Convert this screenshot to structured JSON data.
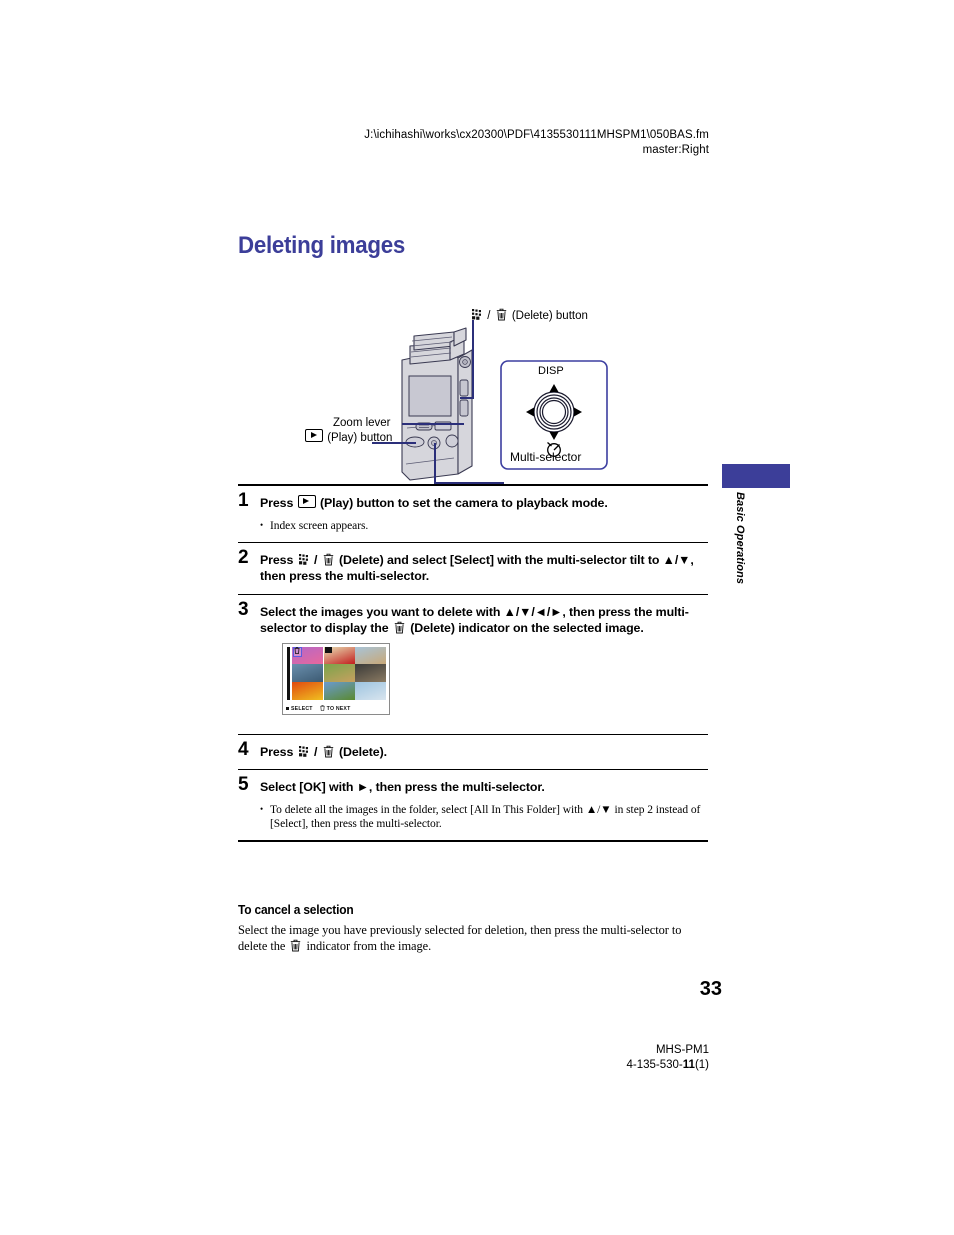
{
  "header": {
    "file_path": "J:\\ichihashi\\works\\cx20300\\PDF\\4135530111MHSPM1\\050BAS.fm",
    "master": "master:Right"
  },
  "title": "Deleting images",
  "figure": {
    "delete_button_label": "(Delete) button",
    "zoom_lever_label": "Zoom lever",
    "play_button_label": "(Play) button",
    "multi_selector_label": "Multi-selector",
    "disp_label": "DISP",
    "icons": {
      "index": "index-grid-icon",
      "trash": "trash-icon",
      "play": "play-icon",
      "self_timer": "self-timer-icon"
    }
  },
  "steps": [
    {
      "number": "1",
      "text_before": "Press",
      "text_after": "(Play) button to set the camera to playback mode.",
      "note": "Index screen appears."
    },
    {
      "number": "2",
      "text_before": "Press",
      "text_after": "(Delete) and select [Select] with the multi-selector tilt to ▲/▼, then press the multi-selector."
    },
    {
      "number": "3",
      "text_line1": "Select the images you want to delete with ▲/▼/◄/►, then press the multi-",
      "text_line2a": "selector to display the",
      "text_line2b": "(Delete) indicator on the selected image."
    },
    {
      "number": "4",
      "text_before": "Press",
      "text_after": "(Delete)."
    },
    {
      "number": "5",
      "text": "Select [OK] with ►, then press the multi-selector.",
      "note": "To delete all the images in the folder, select [All In This Folder] with ▲/▼ in step 2 instead of [Select], then press the multi-selector."
    }
  ],
  "index_screen": {
    "status_select": "SELECT",
    "status_to_next": "TO NEXT",
    "thumbnails": [
      {
        "top": "#b469c8",
        "bottom": "#e8679c",
        "selected": true
      },
      {
        "top": "#e8e0b4",
        "bottom": "#c21d1d"
      },
      {
        "top": "#a8c4d8",
        "bottom": "#c8a878"
      },
      {
        "top": "#6a8fae",
        "bottom": "#3c5a72"
      },
      {
        "top": "#7aa44a",
        "bottom": "#c8a060"
      },
      {
        "top": "#3a3a38",
        "bottom": "#8a7a62"
      },
      {
        "top": "#e04a10",
        "bottom": "#f0c020"
      },
      {
        "top": "#6a9ad0",
        "bottom": "#5a8a30"
      },
      {
        "top": "#9dc4e0",
        "bottom": "#d8e4ee"
      }
    ]
  },
  "cancel_section": {
    "heading": "To cancel a selection",
    "body_part1": "Select the image you have previously selected for deletion, then press the multi-selector to delete the",
    "body_part2": "indicator from the image."
  },
  "side_tab": {
    "label": "Basic Operations"
  },
  "footer": {
    "page_number": "33",
    "model": "MHS-PM1",
    "part_number_prefix": "4-135-530-",
    "part_number_bold": "11",
    "part_number_suffix": "(1)"
  },
  "colors": {
    "accent_blue": "#3c3e99",
    "line_blue": "#2b2f7a"
  }
}
